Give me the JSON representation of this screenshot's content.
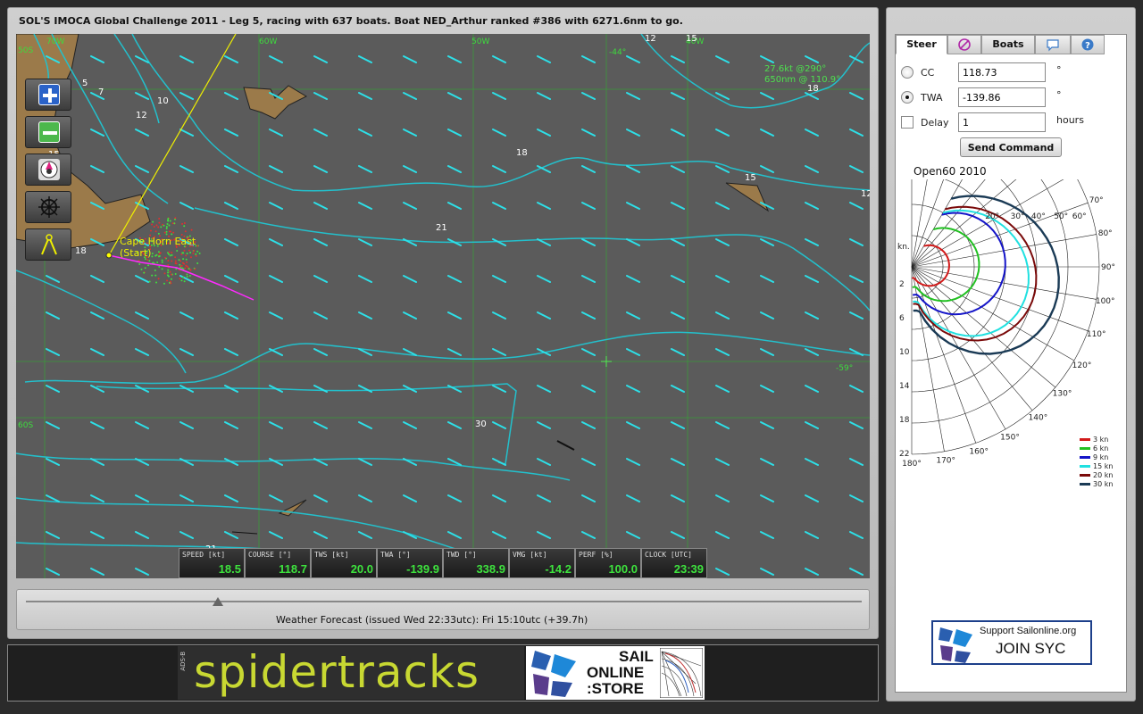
{
  "header": {
    "title": "SOL'S IMOCA Global Challenge 2011 - Leg 5, racing with 637 boats. Boat NED_Arthur ranked #386 with 6271.6nm to go."
  },
  "map": {
    "lon_labels": [
      "70W",
      "60W",
      "50W",
      "40W"
    ],
    "lat_labels": [
      "50S",
      "60S"
    ],
    "lat_readout": "-44°",
    "lat_readout_right": "-59°",
    "wind_info": [
      "27.6kt @290°",
      "650nm @ 110.9°"
    ],
    "start_label_1": "Cape Horn East",
    "start_label_2": "(Start)",
    "contour_labels": [
      "12",
      "15",
      "18",
      "5",
      "7",
      "10",
      "12",
      "15",
      "18",
      "21",
      "18",
      "15",
      "12",
      "30",
      "21"
    ]
  },
  "toolbar": [
    {
      "icon": "zoom-in-icon"
    },
    {
      "icon": "zoom-out-icon"
    },
    {
      "icon": "compass-icon"
    },
    {
      "icon": "helm-icon"
    },
    {
      "icon": "divider-icon"
    }
  ],
  "instruments": [
    {
      "label": "SPEED [kt]",
      "value": "18.5"
    },
    {
      "label": "COURSE [°]",
      "value": "118.7"
    },
    {
      "label": "TWS [kt]",
      "value": "20.0"
    },
    {
      "label": "TWA [°]",
      "value": "-139.9"
    },
    {
      "label": "TWD [°]",
      "value": "338.9"
    },
    {
      "label": "VMG [kt]",
      "value": "-14.2"
    },
    {
      "label": "PERF [%]",
      "value": "100.0"
    },
    {
      "label": "CLOCK [UTC]",
      "value": "23:39"
    }
  ],
  "timeline": {
    "forecast": "Weather Forecast  (issued Wed 22:33utc): Fri 15:10utc  (+39.7h)",
    "position_fraction": 0.23
  },
  "tabs": [
    {
      "label": "Steer",
      "active": true
    },
    {
      "label": "",
      "icon": "no-entry-icon"
    },
    {
      "label": "Boats"
    },
    {
      "label": "",
      "icon": "chat-icon"
    },
    {
      "label": "",
      "icon": "help-icon"
    }
  ],
  "steer": {
    "cc_label": "CC",
    "cc_value": "118.73",
    "twa_label": "TWA",
    "twa_value": "-139.86",
    "delay_label": "Delay",
    "delay_value": "1",
    "deg_unit": "°",
    "hours_unit": "hours",
    "send_label": "Send Command"
  },
  "polar": {
    "title": "Open60 2010",
    "angle_labels": [
      "20°",
      "30°",
      "40°",
      "50°",
      "60°",
      "70°",
      "80°",
      "90°",
      "100°",
      "110°",
      "120°",
      "130°",
      "140°",
      "150°",
      "160°",
      "170°",
      "180°"
    ],
    "kn_label": "kn.",
    "speed_labels": [
      "2",
      "6",
      "10",
      "14",
      "18",
      "22"
    ],
    "legend": [
      {
        "label": "3 kn",
        "color": "#d21a1a"
      },
      {
        "label": "6 kn",
        "color": "#22c022"
      },
      {
        "label": "9 kn",
        "color": "#1414c8"
      },
      {
        "label": "15 kn",
        "color": "#20e0e0"
      },
      {
        "label": "20 kn",
        "color": "#7a0a0a"
      },
      {
        "label": "30 kn",
        "color": "#1a3a55"
      }
    ]
  },
  "support": {
    "line1": "Support Sailonline.org",
    "line2": "JOIN SYC"
  },
  "ads": {
    "spider_side": "ADS-B",
    "spider_text": "spidertracks",
    "store_line1": "SAIL",
    "store_line2": "ONLINE",
    "store_line3": ":STORE"
  }
}
